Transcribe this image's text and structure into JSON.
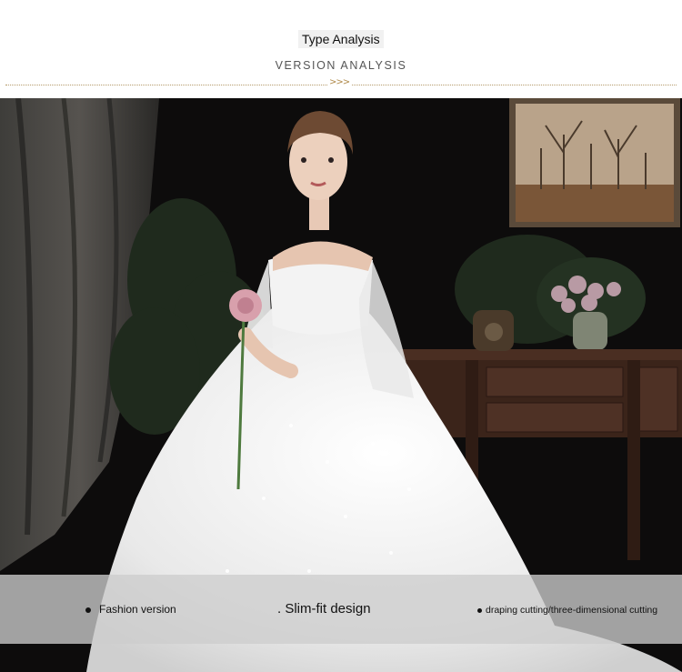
{
  "header": {
    "title": "Type Analysis",
    "subtitle": "VERSION ANALYSIS",
    "arrows": ">>>"
  },
  "captions": {
    "item1": "Fashion version",
    "item2": ". Slim-fit design",
    "item3": "draping cutting/three-dimensional cutting"
  },
  "colors": {
    "accent": "#b08a4a",
    "background": "#0b0a0a"
  }
}
